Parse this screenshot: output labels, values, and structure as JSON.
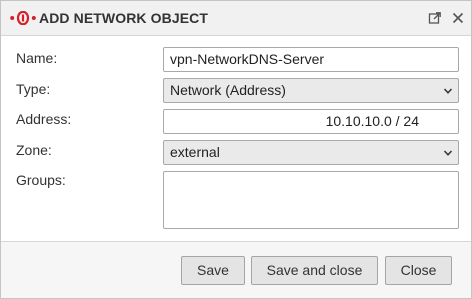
{
  "dialog": {
    "title": "ADD NETWORK OBJECT",
    "logo_icon": "securepoint-logo",
    "popout_icon": "popout-icon",
    "close_icon": "close-icon"
  },
  "form": {
    "name": {
      "label": "Name:",
      "value": "vpn-NetworkDNS-Server"
    },
    "type": {
      "label": "Type:",
      "value": "Network (Address)"
    },
    "address": {
      "label": "Address:",
      "value": "10.10.10.0 / 24"
    },
    "zone": {
      "label": "Zone:",
      "value": "external"
    },
    "groups": {
      "label": "Groups:",
      "value": ""
    }
  },
  "buttons": {
    "save": "Save",
    "save_and_close": "Save and close",
    "close": "Close"
  },
  "colors": {
    "logo_red": "#d4202a",
    "background": "#ffffff",
    "footer": "#f6f6f6"
  }
}
